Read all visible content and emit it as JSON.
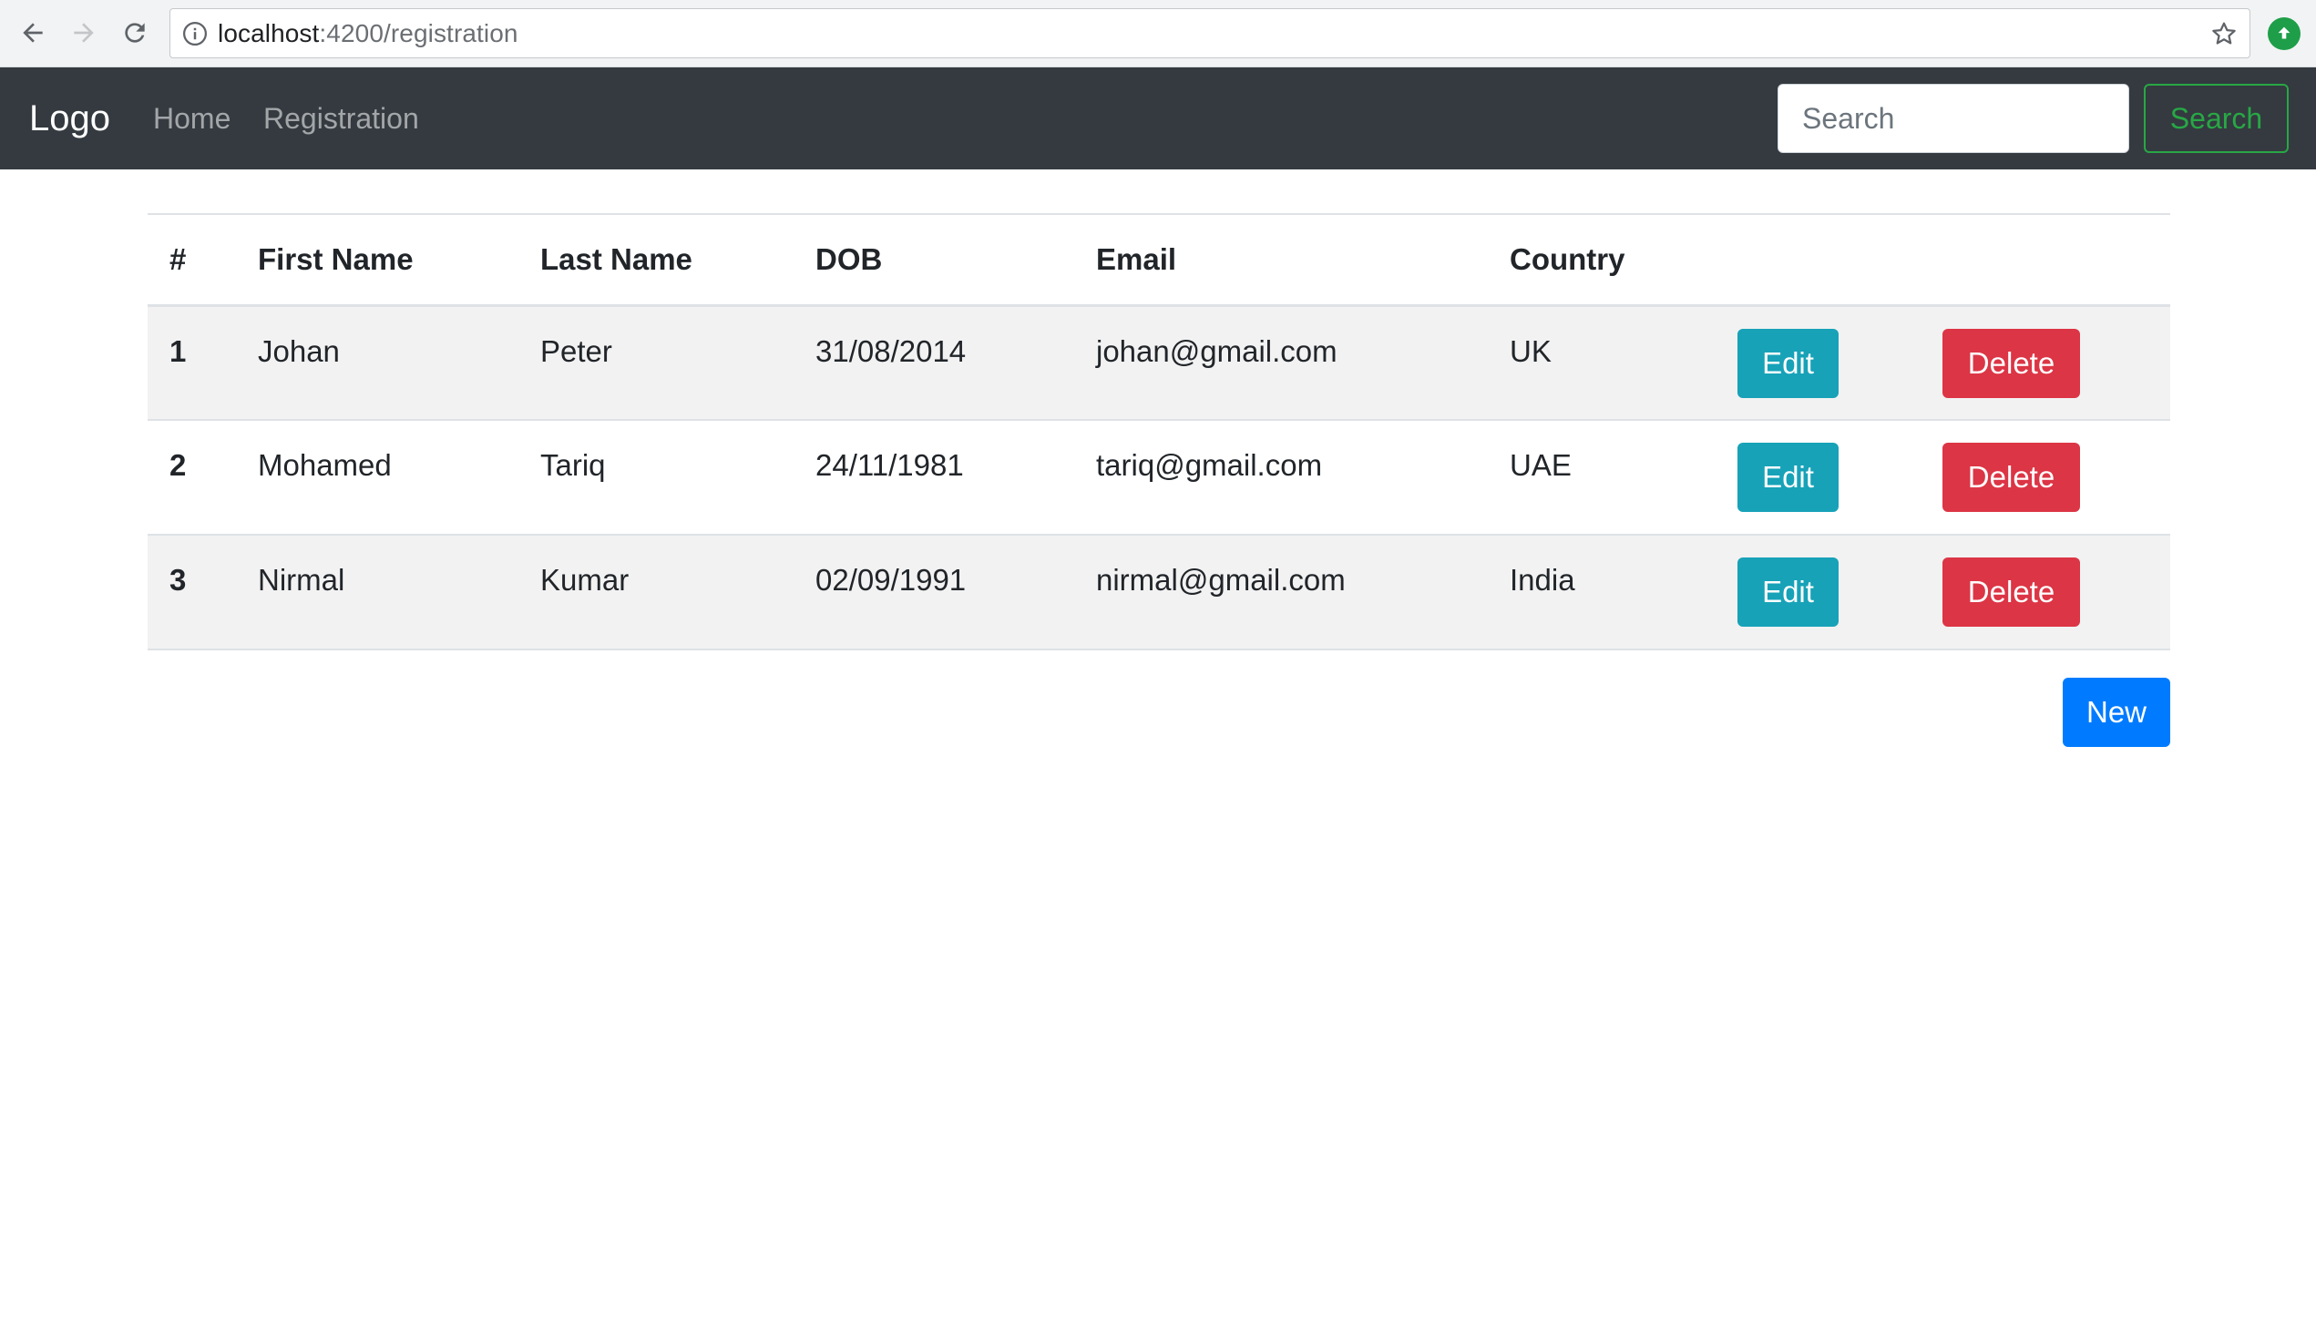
{
  "browser": {
    "url_host": "localhost",
    "url_rest": ":4200/registration"
  },
  "navbar": {
    "brand": "Logo",
    "links": [
      "Home",
      "Registration"
    ],
    "search_placeholder": "Search",
    "search_button": "Search",
    "colors": {
      "background": "#343a40",
      "search_button": "#28a745"
    }
  },
  "table": {
    "headers": [
      "#",
      "First Name",
      "Last Name",
      "DOB",
      "Email",
      "Country"
    ],
    "rows": [
      {
        "num": "1",
        "first_name": "Johan",
        "last_name": "Peter",
        "dob": "31/08/2014",
        "email": "johan@gmail.com",
        "country": "UK",
        "edit_label": "Edit",
        "delete_label": "Delete"
      },
      {
        "num": "2",
        "first_name": "Mohamed",
        "last_name": "Tariq",
        "dob": "24/11/1981",
        "email": "tariq@gmail.com",
        "country": "UAE",
        "edit_label": "Edit",
        "delete_label": "Delete"
      },
      {
        "num": "3",
        "first_name": "Nirmal",
        "last_name": "Kumar",
        "dob": "02/09/1991",
        "email": "nirmal@gmail.com",
        "country": "India",
        "edit_label": "Edit",
        "delete_label": "Delete"
      }
    ],
    "colors": {
      "edit": "#17a2b8",
      "delete": "#dc3545",
      "stripe": "#f2f2f2"
    }
  },
  "actions": {
    "new_label": "New",
    "new_color": "#007bff"
  },
  "icons": {
    "back": "arrow-left-icon",
    "forward": "arrow-right-icon",
    "reload": "reload-icon",
    "info": "info-icon",
    "star": "star-icon",
    "extension": "extension-upload-icon"
  }
}
